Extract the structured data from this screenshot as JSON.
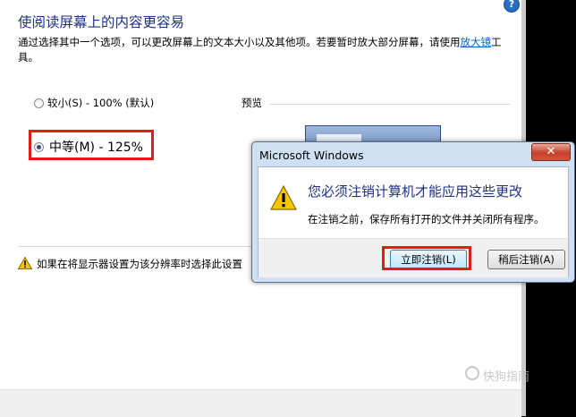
{
  "panel": {
    "title": "使阅读屏幕上的内容更容易",
    "intro_text": "通过选择其中一个选项，可以更改屏幕上的文本大小以及其他项。若要暂时放大部分屏幕，请使用",
    "intro_link": "放大镜",
    "intro_suffix": "工具。",
    "options": [
      {
        "label": "较小(S) - 100% (默认)",
        "selected": false
      },
      {
        "label": "中等(M) - 125%",
        "selected": true
      }
    ],
    "preview_label": "预览",
    "warning_text": "如果在将显示器设置为该分辨率时选择此设置"
  },
  "dialog": {
    "title": "Microsoft Windows",
    "close_label": "✕",
    "main_instruction": "您必须注销计算机才能应用这些更改",
    "content": "在注销之前，保存所有打开的文件并关闭所有程序。",
    "buttons": {
      "logoff_now": "立即注销(L)",
      "logoff_later": "稍后注销(A)"
    }
  },
  "help_label": "?",
  "watermark": "快狗指南",
  "colors": {
    "title_blue": "#1e3287",
    "link_blue": "#0066cc",
    "highlight_red": "#e41b17",
    "dialog_frame": "#cfe0f2"
  },
  "icons": {
    "warning": "warning-icon",
    "help": "help-icon",
    "close": "close-icon"
  }
}
